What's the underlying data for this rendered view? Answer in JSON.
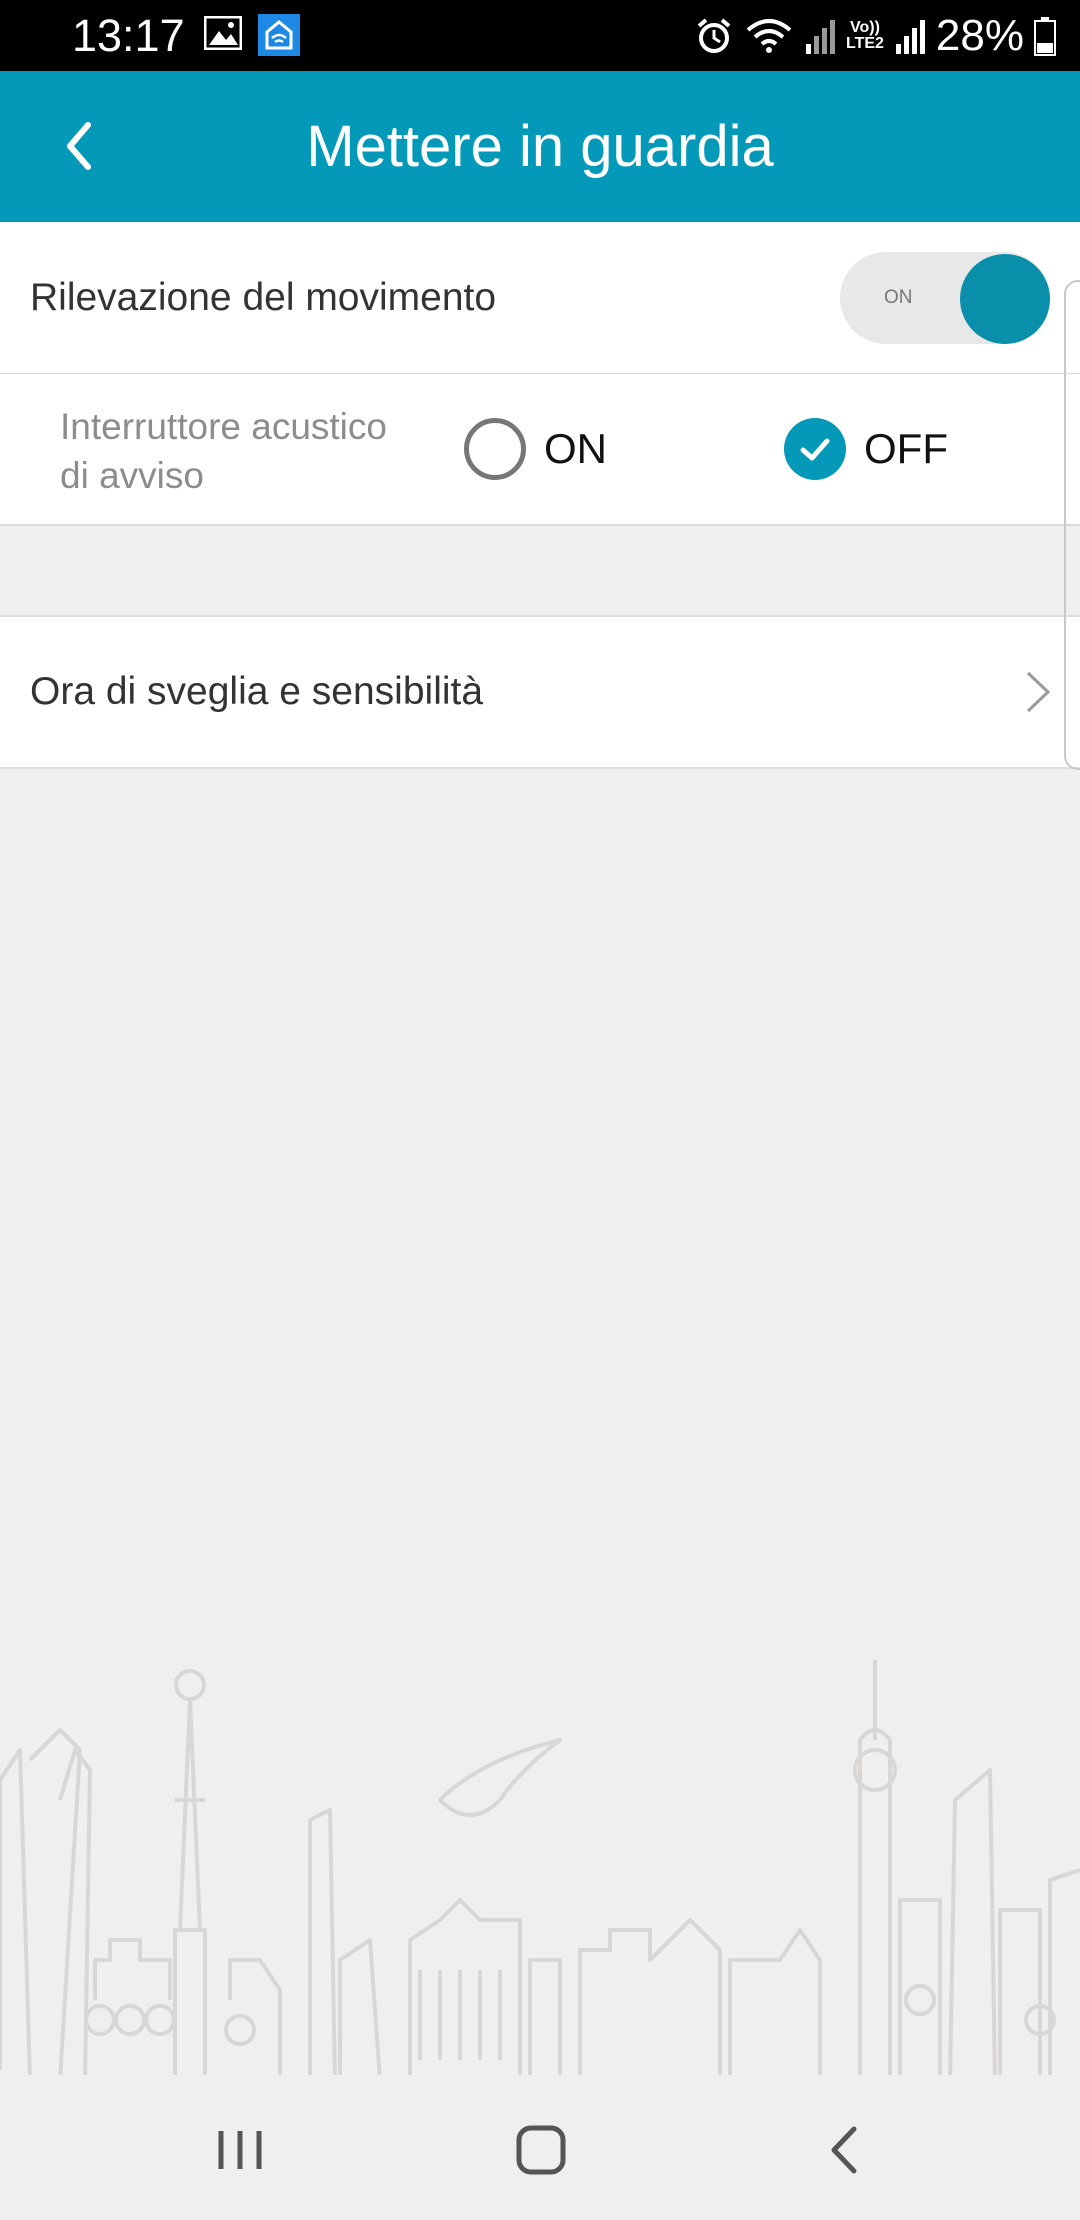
{
  "status_bar": {
    "time": "13:17",
    "network_top": "Vo))",
    "network_bottom": "LTE2",
    "battery": "28%"
  },
  "header": {
    "title": "Mettere in guardia"
  },
  "motion_detection": {
    "label": "Rilevazione del movimento",
    "toggle_text": "ON",
    "enabled": true
  },
  "alarm_sound": {
    "label": "Interruttore acustico di avviso",
    "options": [
      {
        "label": "ON",
        "selected": false
      },
      {
        "label": "OFF",
        "selected": true
      }
    ]
  },
  "wake_time": {
    "label": "Ora di sveglia e sensibilità"
  },
  "colors": {
    "accent": "#0499b8",
    "knob": "#0a8faa",
    "background": "#efefef"
  },
  "icons": {
    "back": "chevron-left-icon",
    "row_chevron": "chevron-right-icon",
    "nav_recent": "recent-apps-icon",
    "nav_home": "home-icon",
    "nav_back": "back-icon"
  }
}
